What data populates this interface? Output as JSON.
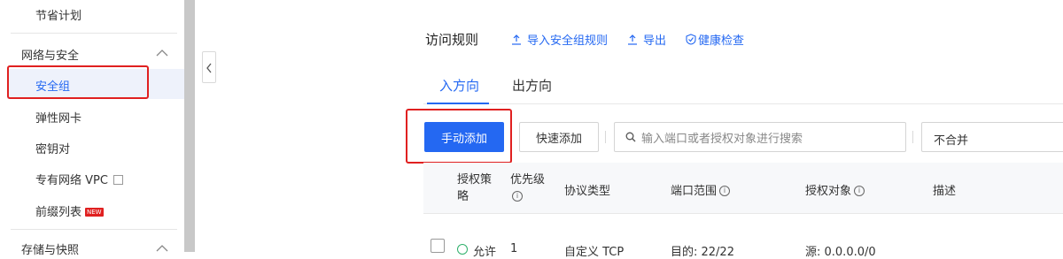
{
  "sidebar": {
    "item_top": "节省计划",
    "group_network": "网络与安全",
    "items": [
      {
        "label": "安全组"
      },
      {
        "label": "弹性网卡"
      },
      {
        "label": "密钥对"
      },
      {
        "label": "专有网络 VPC"
      },
      {
        "label": "前缀列表"
      }
    ],
    "new_badge": "NEW",
    "group_storage": "存储与快照"
  },
  "main": {
    "heading": "访问规则",
    "actions": {
      "import": "导入安全组规则",
      "export": "导出",
      "health": "健康检查"
    },
    "tabs": [
      {
        "label": "入方向",
        "active": true
      },
      {
        "label": "出方向",
        "active": false
      }
    ],
    "toolbar": {
      "add_manual": "手动添加",
      "add_quick": "快速添加",
      "search_placeholder": "输入端口或者授权对象进行搜索",
      "merge_select": "不合并"
    },
    "table": {
      "headers": {
        "policy_line1": "授权策",
        "policy_line2": "略",
        "priority": "优先级",
        "protocol": "协议类型",
        "port": "端口范围",
        "target": "授权对象",
        "desc": "描述"
      },
      "row": {
        "policy": "允许",
        "priority": "1",
        "protocol": "自定义 TCP",
        "port": "目的: 22/22",
        "target": "源: 0.0.0.0/0"
      }
    }
  },
  "colors": {
    "accent": "#2468f2",
    "highlight_border": "#e02020",
    "allow_green": "#2fb06b"
  }
}
